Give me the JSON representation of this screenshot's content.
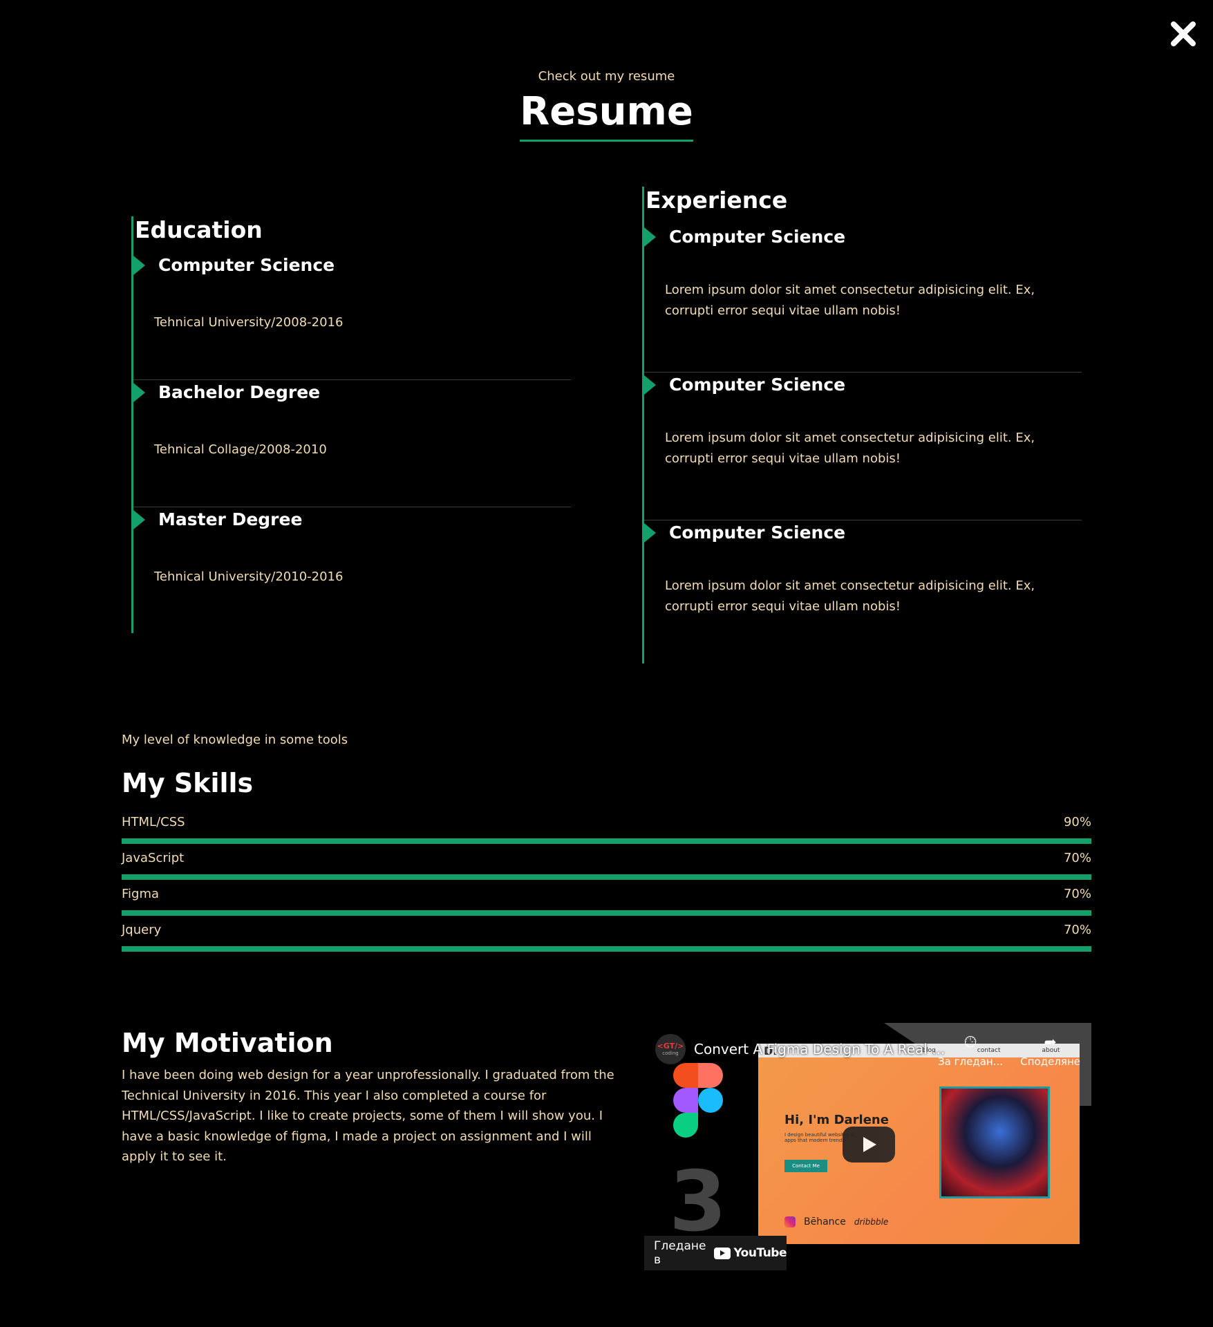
{
  "header": {
    "subtitle": "Check out my resume",
    "title": "Resume"
  },
  "education": {
    "heading": "Education",
    "items": [
      {
        "title": "Computer Science",
        "detail": "Tehnical University/2008-2016"
      },
      {
        "title": "Bachelor Degree",
        "detail": "Tehnical Collage/2008-2010"
      },
      {
        "title": "Master Degree",
        "detail": "Tehnical University/2010-2016"
      }
    ]
  },
  "experience": {
    "heading": "Experience",
    "items": [
      {
        "title": "Computer Science",
        "detail": "Lorem ipsum dolor sit amet consectetur adipisicing elit. Ex, corrupti error sequi vitae ullam nobis!"
      },
      {
        "title": "Computer Science",
        "detail": "Lorem ipsum dolor sit amet consectetur adipisicing elit. Ex, corrupti error sequi vitae ullam nobis!"
      },
      {
        "title": "Computer Science",
        "detail": "Lorem ipsum dolor sit amet consectetur adipisicing elit. Ex, corrupti error sequi vitae ullam nobis!"
      }
    ]
  },
  "skills": {
    "subtitle": "My level of knowledge in some tools",
    "heading": "My Skills",
    "items": [
      {
        "name": "HTML/CSS",
        "percent_label": "90%",
        "fill": 1.0
      },
      {
        "name": "JavaScript",
        "percent_label": "70%",
        "fill": 1.0
      },
      {
        "name": "Figma",
        "percent_label": "70%",
        "fill": 1.0
      },
      {
        "name": "Jquery",
        "percent_label": "70%",
        "fill": 1.0
      }
    ]
  },
  "motivation": {
    "heading": "My Motivation",
    "text": "I have been doing web design for a year unprofessionally. I graduated from the Technical University in 2016. This year I also completed a course for HTML/CSS/JavaScript. I like to create projects, some of them I will show you. I have a basic knowledge of figma, I made a project on assignment and I will apply it to see it."
  },
  "video": {
    "channel_badge": "<GT/>",
    "channel_badge_sub": "coding",
    "title": "Convert A Figma Design To A Real ...",
    "watch_later_label": "За гледан...",
    "share_label": "Споделяне",
    "watch_on_label": "Гледане в",
    "youtube_label": "YouTube",
    "thumbnail": {
      "logo": "D.",
      "nav": [
        "blog",
        "contact",
        "about"
      ],
      "hero_title": "Hi, I'm Darlene",
      "hero_sub": "I design beautiful websites & apps that modern trends",
      "contact_label": "Contact Me",
      "behance_label": "Bēhance",
      "dribbble_label": "dribbble"
    },
    "big_number": "3"
  },
  "icons": {
    "close": "close-icon",
    "play": "play-icon",
    "clock": "clock-icon",
    "share": "share-icon"
  },
  "colors": {
    "accent": "#13a06b",
    "text_muted": "#f2dcb3",
    "background": "#000000"
  }
}
